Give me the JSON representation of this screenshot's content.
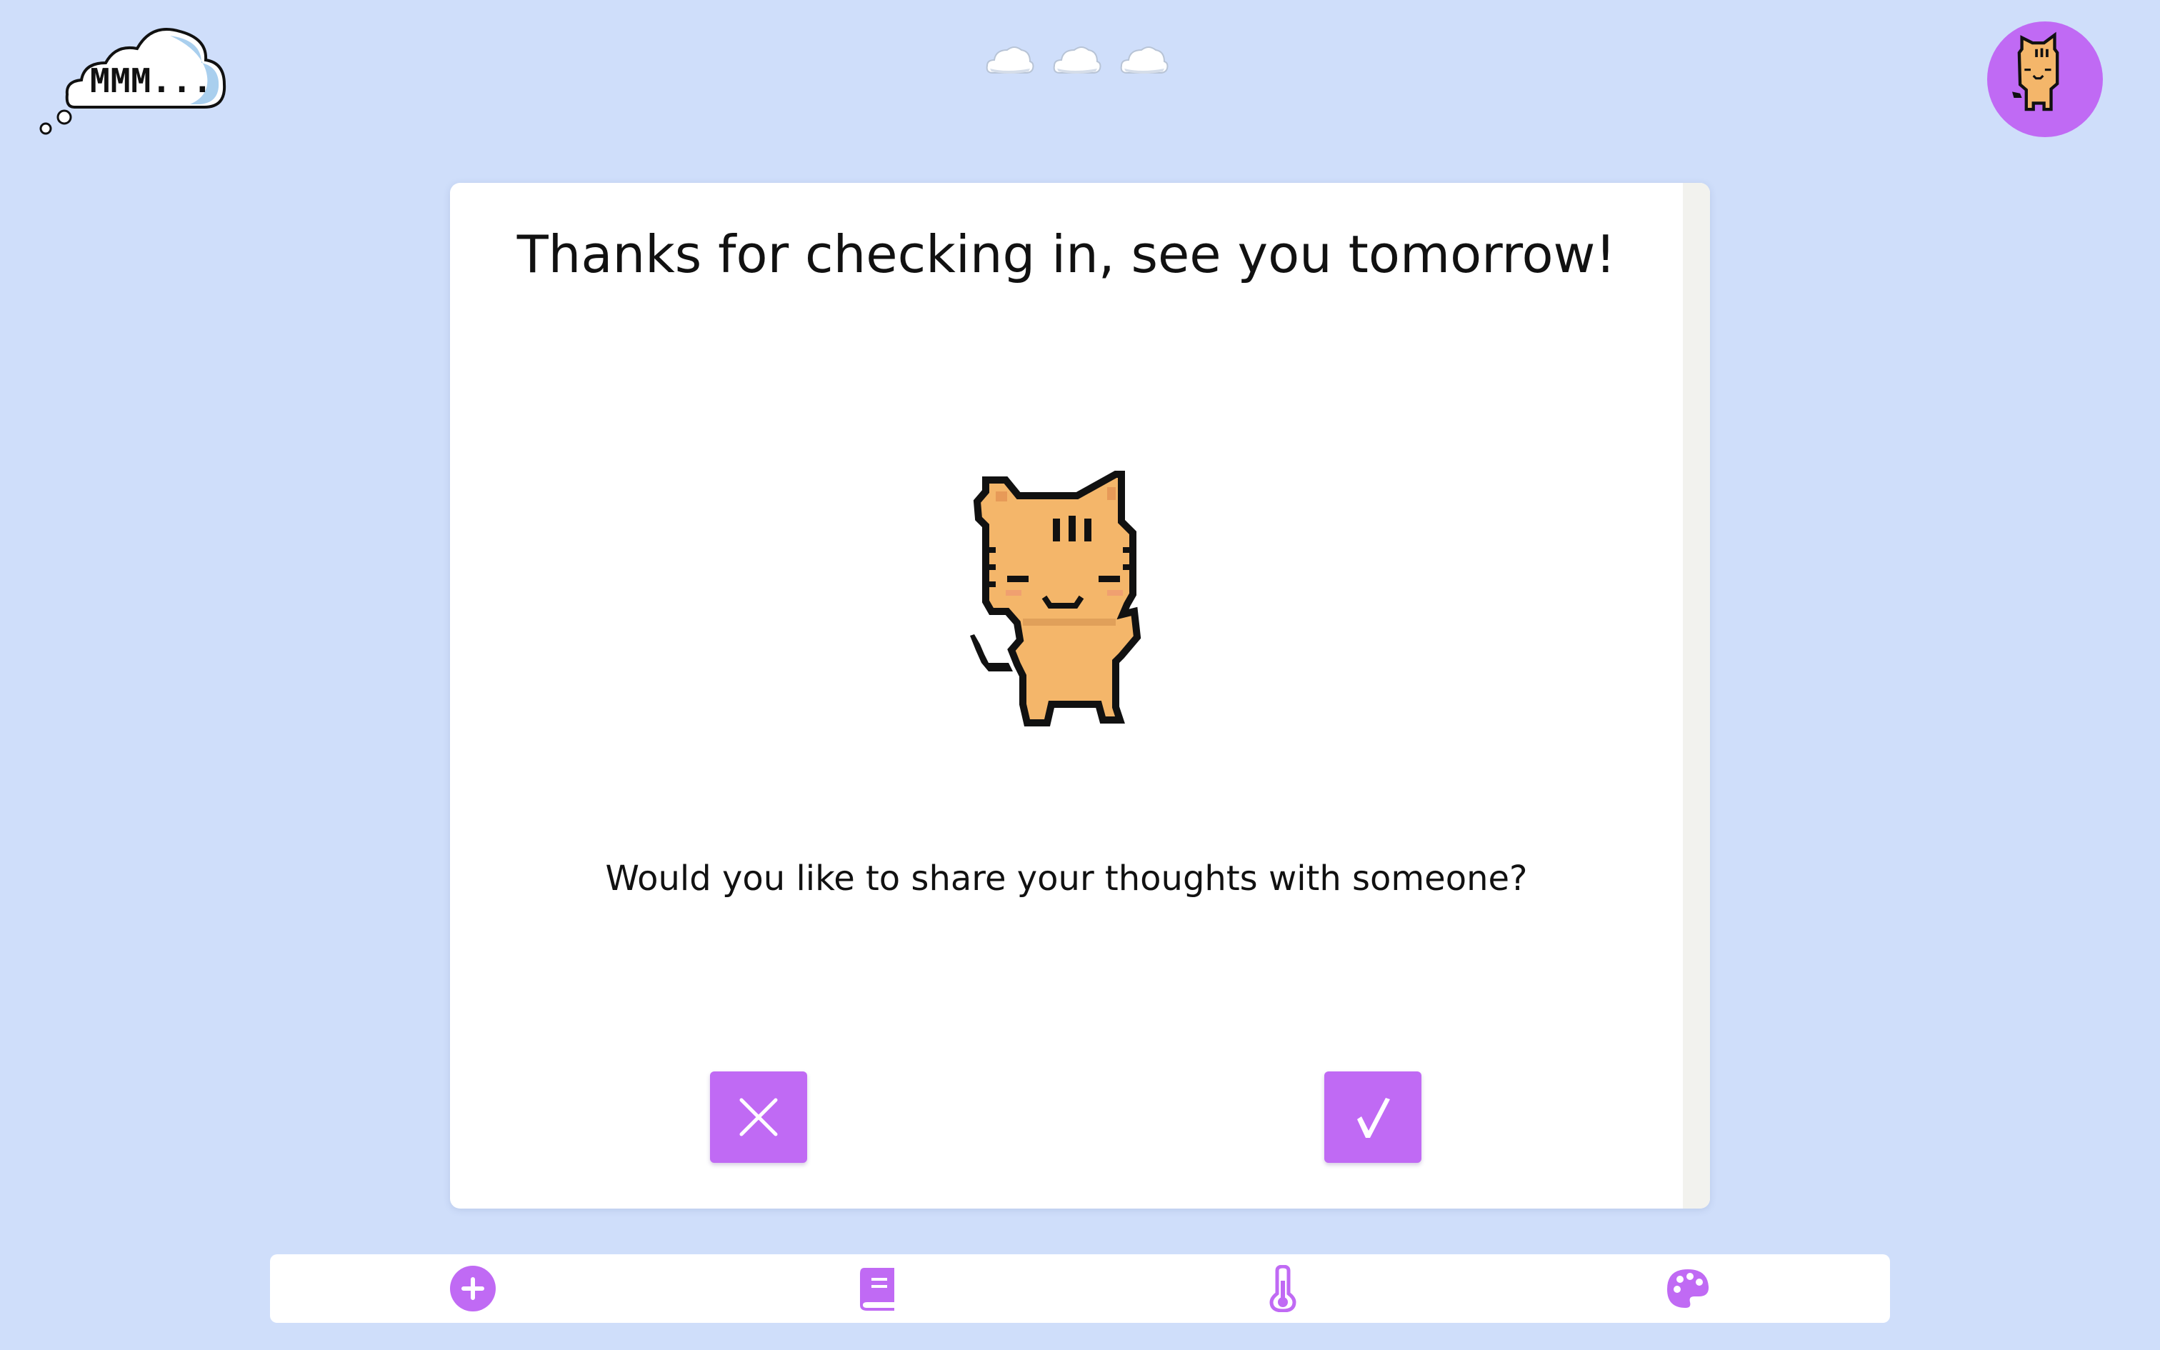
{
  "header": {
    "logo_text": "MMM...",
    "clouds": [
      "cloud-icon",
      "cloud-icon",
      "cloud-icon"
    ],
    "avatar": "cat-avatar"
  },
  "dialog": {
    "title": "Thanks for checking in, see you tomorrow!",
    "question": "Would you like to share your thoughts with someone?",
    "no_button_icon": "close-icon",
    "yes_button_icon": "checkmark-icon"
  },
  "bottom_nav": {
    "items": [
      {
        "icon": "add-icon"
      },
      {
        "icon": "journal-icon"
      },
      {
        "icon": "thermometer-icon"
      },
      {
        "icon": "palette-icon"
      }
    ]
  },
  "colors": {
    "background": "#cfdefa",
    "accent": "#c06af4",
    "cat_fur": "#f4b66a",
    "cat_outline": "#111111"
  }
}
